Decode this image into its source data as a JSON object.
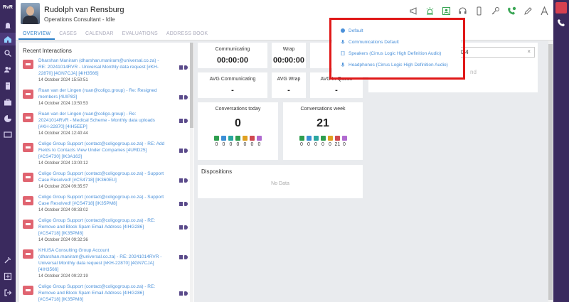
{
  "app": {
    "logo": "RvR"
  },
  "user": {
    "name": "Rudolph van Rensburg",
    "status": "Operations Consultant - Idle"
  },
  "tabs": [
    {
      "label": "OVERVIEW",
      "active": true
    },
    {
      "label": "CASES"
    },
    {
      "label": "CALENDAR"
    },
    {
      "label": "EVALUATIONS"
    },
    {
      "label": "ADDRESS BOOK"
    }
  ],
  "recent": {
    "title": "Recent Interactions",
    "items": [
      {
        "text": "Dharshan Maniram (dharshan.maniram@universal.co.za) - RE: 20241014RVR - Universal Monthly data request [#KH-22870] [4GN7CJA] [4IH3566]",
        "date": "14 October 2024 15:50:51"
      },
      {
        "text": "Ruan van der Lingen (ruan@coligo.group) - Re: Resigned members [4UIP83]",
        "date": "14 October 2024 13:50:53"
      },
      {
        "text": "Ruan van der Lingen (ruan@coligo.group) - Re: 20241014RVR - Medical Scheme - Monthly data uploads [#KH-22870] [4IH5EEP]",
        "date": "14 October 2024 12:40:44"
      },
      {
        "text": "Coligo Group Support (contact@coligogroup.co.za) - RE: Add Fields to Contacts View Under Companies [4URD25] [#CS4730] [IK3A163]",
        "date": "14 October 2024 13:00:12"
      },
      {
        "text": "Coligo Group Support (contact@coligogroup.co.za) - Support Case Resolved! [#CS4718] [IK360EU]",
        "date": "14 October 2024 09:35:57"
      },
      {
        "text": "Coligo Group Support (contact@coligogroup.co.za) - Support Case Resolved! [#CS4718] [IK35PM8]",
        "date": "14 October 2024 09:33:02"
      },
      {
        "text": "Coligo Group Support (contact@coligogroup.co.za) - RE: Remove and Block Spam Email Address [4IHG286] [#CS4718] [IK35PM8]",
        "date": "14 October 2024 09:32:36"
      },
      {
        "text": "KHUSA Consulting Group Account (dharshan.maniram@universal.co.za) - RE: 20241014RVR - Universal Monthly data request [#KH-22870] [4GN7CJA] [4IH3566]",
        "date": "14 October 2024 09:22:19"
      },
      {
        "text": "Coligo Group Support (contact@coligogroup.co.za) - RE: Remove and Block Spam Email Address [4IHG286] [#CS4718] [IK35PM8]",
        "date": ""
      }
    ]
  },
  "stats": {
    "communicating": {
      "label": "Communicating",
      "value": "00:00:00"
    },
    "wrap": {
      "label": "Wrap",
      "value": "00:00:00"
    },
    "third_label_fragment": "C",
    "avg_communicating": {
      "label": "AVG Communicating",
      "value": "-"
    },
    "avg_wrap": {
      "label": "AVG Wrap",
      "value": "-"
    },
    "avg_third_label": "AVG In Queue",
    "conv_today": {
      "label": "Conversations today",
      "value": "0",
      "counts": [
        "0",
        "0",
        "0",
        "0",
        "0",
        "0",
        "0"
      ]
    },
    "conv_week": {
      "label": "Conversations week",
      "value": "21",
      "counts": [
        "0",
        "0",
        "0",
        "0",
        "0",
        "21",
        "0"
      ]
    },
    "channel_colors": [
      "#2e9e4f",
      "#3b8fd6",
      "#2aa7a0",
      "#2e9e4f",
      "#e0a020",
      "#d04850",
      "#b06ad0"
    ]
  },
  "dispositions": {
    "title": "Dispositions",
    "empty": "No Data"
  },
  "search_panel": {
    "date_value": "5/10/2024",
    "clear": "×",
    "ghost_text": "nd"
  },
  "audio_menu": {
    "options": [
      {
        "label": "Default",
        "icon": "check-circle-icon"
      },
      {
        "label": "Communications Default",
        "icon": "microphone-icon"
      },
      {
        "label": "Speakers (Cirrus Logic High Definition Audio)",
        "icon": "speaker-icon"
      },
      {
        "label": "Headphones (Cirrus Logic High Definition Audio)",
        "icon": "microphone-icon"
      }
    ],
    "highlight_color": "#e01818"
  }
}
